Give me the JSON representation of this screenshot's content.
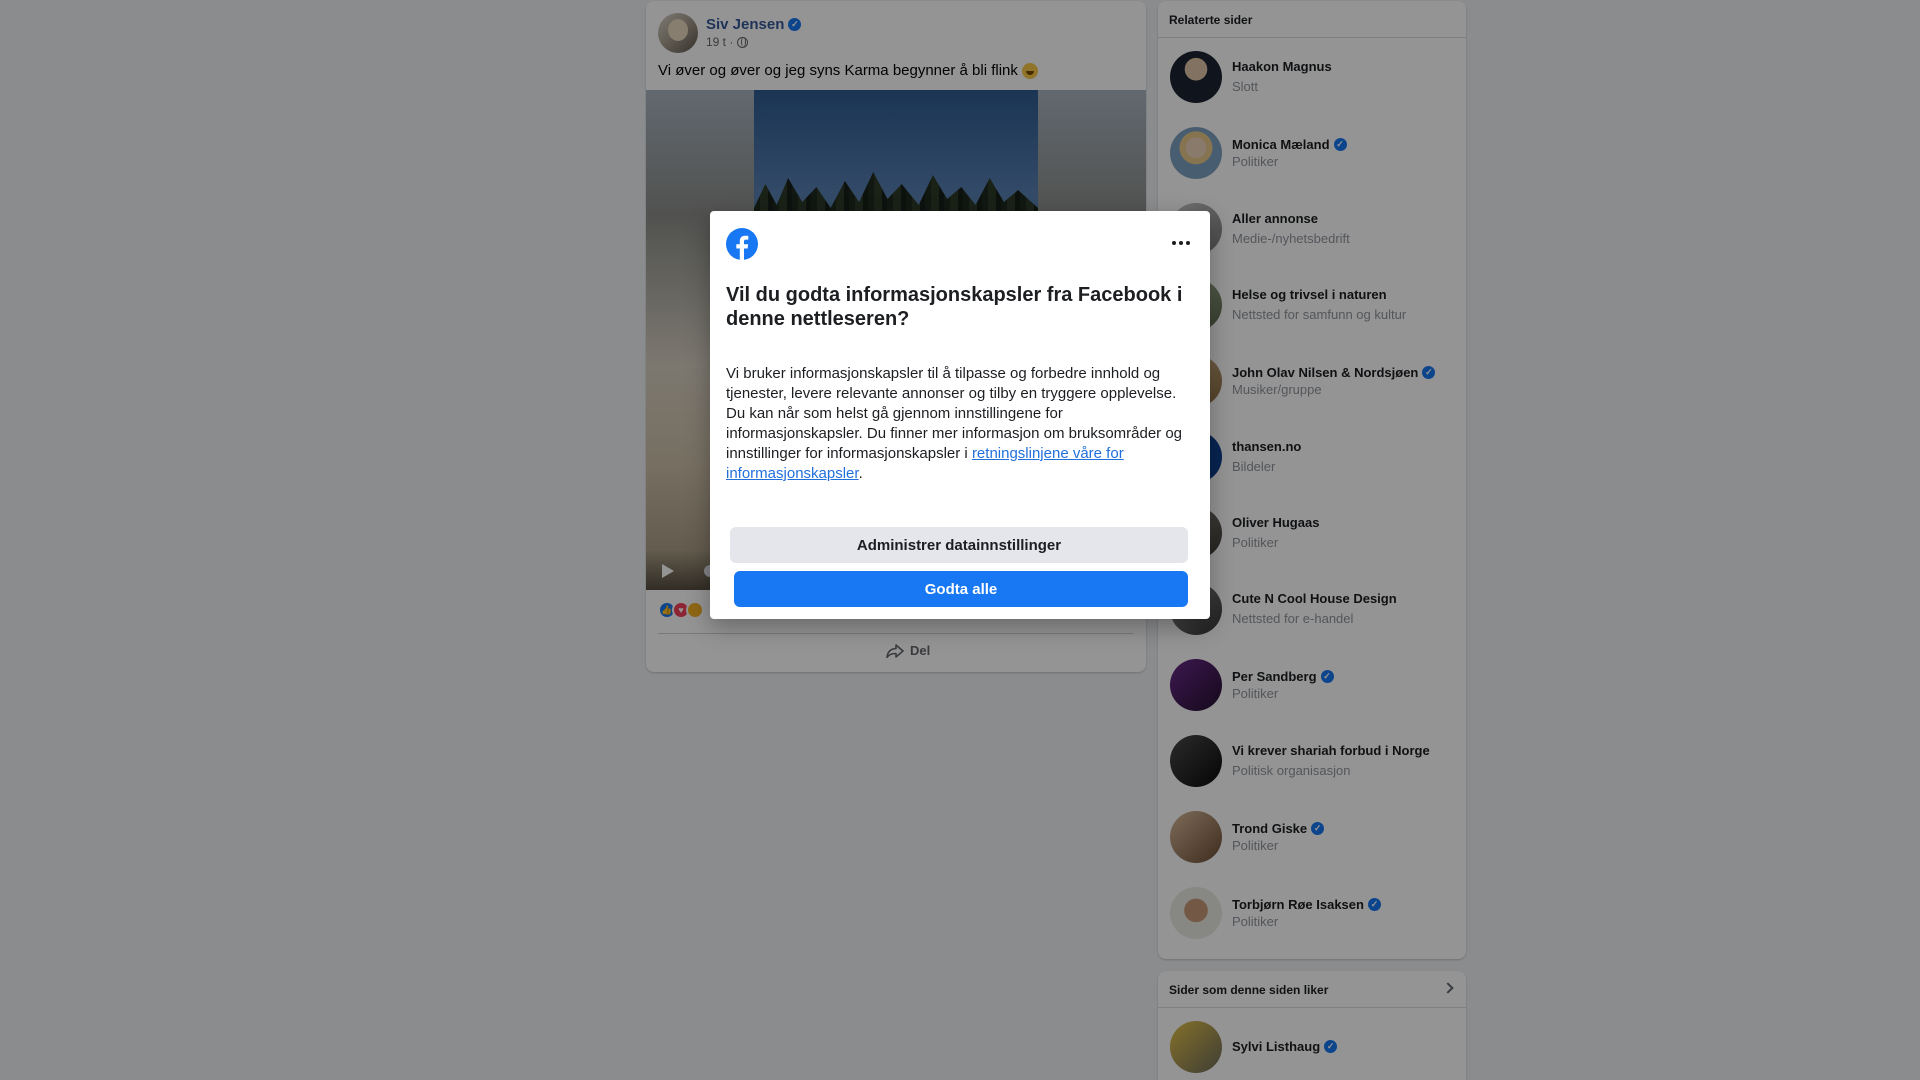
{
  "post": {
    "author": "Siv Jensen",
    "time": "19 t ·",
    "text": "Vi øver og øver og jeg syns Karma begynner å bli flink",
    "share_label": "Del"
  },
  "related": {
    "title": "Relaterte sider",
    "items": [
      {
        "name": "Haakon Magnus",
        "category": "Slott",
        "verified": false
      },
      {
        "name": "Monica Mæland",
        "category": "Politiker",
        "verified": true
      },
      {
        "name": "Aller annonse",
        "category": "Medie-/nyhetsbedrift",
        "verified": false
      },
      {
        "name": "Helse og trivsel i naturen",
        "category": "Nettsted for samfunn og kultur",
        "verified": false
      },
      {
        "name": "John Olav Nilsen & Nordsjøen",
        "category": "Musiker/gruppe",
        "verified": true
      },
      {
        "name": "thansen.no",
        "category": "Bildeler",
        "verified": false
      },
      {
        "name": "Oliver Hugaas",
        "category": "Politiker",
        "verified": false
      },
      {
        "name": "Cute N Cool House Design",
        "category": "Nettsted for e-handel",
        "verified": false
      },
      {
        "name": "Per Sandberg",
        "category": "Politiker",
        "verified": true
      },
      {
        "name": "Vi krever shariah forbud i Norge",
        "category": "Politisk organisasjon",
        "verified": false
      },
      {
        "name": "Trond Giske",
        "category": "Politiker",
        "verified": true
      },
      {
        "name": "Torbjørn Røe Isaksen",
        "category": "Politiker",
        "verified": true
      }
    ]
  },
  "pages_liked": {
    "title": "Sider som denne siden liker",
    "items": [
      {
        "name": "Sylvi Listhaug",
        "verified": true
      }
    ]
  },
  "cookie_dialog": {
    "title": "Vil du godta informasjonskapsler fra Facebook i denne nettleseren?",
    "body_text": "Vi bruker informasjonskapsler til å tilpasse og forbedre innhold og tjenester, levere relevante annonser og tilby en tryggere opplevelse. Du kan når som helst gå gjennom innstillingene for informasjonskapsler. Du finner mer informasjon om bruksområder og innstillinger for informasjonskapsler i ",
    "link_text": "retningslinjene våre for informasjonskapsler",
    "body_end": ".",
    "manage_label": "Administrer datainnstillinger",
    "accept_label": "Godta alle"
  },
  "colors": {
    "brand_blue": "#1877f2",
    "link_blue": "#216fdb",
    "author_blue": "#385898"
  }
}
